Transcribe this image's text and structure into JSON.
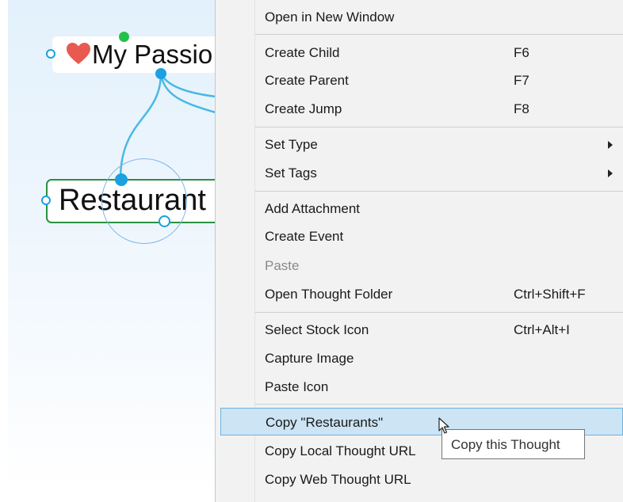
{
  "mindmap": {
    "parent_label": "My Passio",
    "child_label": "Restaurant",
    "colors": {
      "link": "#4ab8e3",
      "node_dot": "#1ba0e0",
      "green_dot": "#22c14a",
      "heart": "#e8594f",
      "child_border": "#2a9140",
      "focus_ring": "#7fb6e6"
    }
  },
  "context_menu": {
    "items": [
      {
        "label": "Open in New Window",
        "shortcut": ""
      },
      {
        "label": "Create Child",
        "shortcut": "F6"
      },
      {
        "label": "Create Parent",
        "shortcut": "F7"
      },
      {
        "label": "Create Jump",
        "shortcut": "F8"
      },
      {
        "label": "Set Type",
        "submenu": true
      },
      {
        "label": "Set Tags",
        "submenu": true
      },
      {
        "label": "Add Attachment",
        "shortcut": ""
      },
      {
        "label": "Create Event",
        "shortcut": ""
      },
      {
        "label": "Paste",
        "disabled": true
      },
      {
        "label": "Open Thought Folder",
        "shortcut": "Ctrl+Shift+F"
      },
      {
        "label": "Select Stock Icon",
        "shortcut": "Ctrl+Alt+I"
      },
      {
        "label": "Capture Image",
        "shortcut": ""
      },
      {
        "label": "Paste Icon",
        "shortcut": ""
      },
      {
        "label": "Copy \"Restaurants\"",
        "highlighted": true
      },
      {
        "label": "Copy Local Thought URL",
        "shortcut": ""
      },
      {
        "label": "Copy Web Thought URL",
        "shortcut": ""
      }
    ],
    "highlight_color": "#cce4f3"
  },
  "tooltip": {
    "text": "Copy this Thought"
  }
}
